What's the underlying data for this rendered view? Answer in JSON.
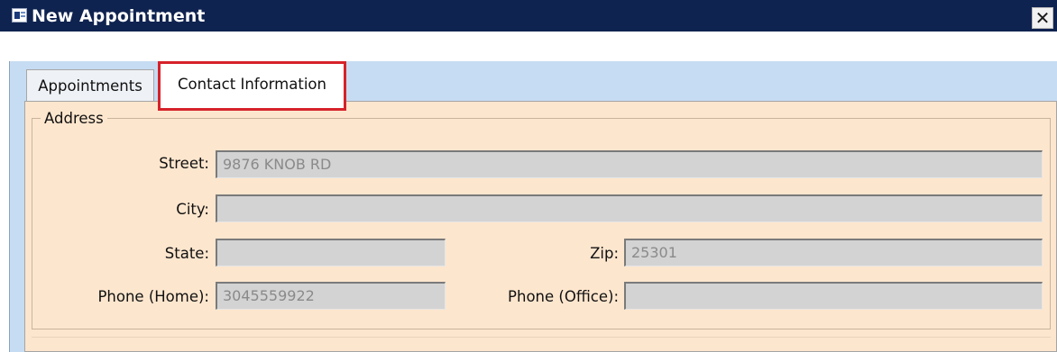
{
  "window": {
    "title": "New Appointment",
    "close_glyph": "✕",
    "icon": "app-window-icon"
  },
  "tabs": [
    {
      "label": "Appointments",
      "selected": false
    },
    {
      "label": "Contact Information",
      "selected": true,
      "highlight_color": "#d6222a"
    }
  ],
  "address": {
    "group_label": "Address",
    "street": {
      "label": "Street:",
      "value": "9876 KNOB RD"
    },
    "city": {
      "label": "City:",
      "value": ""
    },
    "state": {
      "label": "State:",
      "value": ""
    },
    "zip": {
      "label": "Zip:",
      "value": "25301"
    },
    "phone_home": {
      "label": "Phone (Home):",
      "value": "3045559922"
    },
    "phone_office": {
      "label": "Phone (Office):",
      "value": ""
    }
  },
  "colors": {
    "title_bar": "#0f2350",
    "tab_strip": "#c6dcf2",
    "panel": "#fde6ce",
    "field_disabled": "#d3d3d3"
  }
}
